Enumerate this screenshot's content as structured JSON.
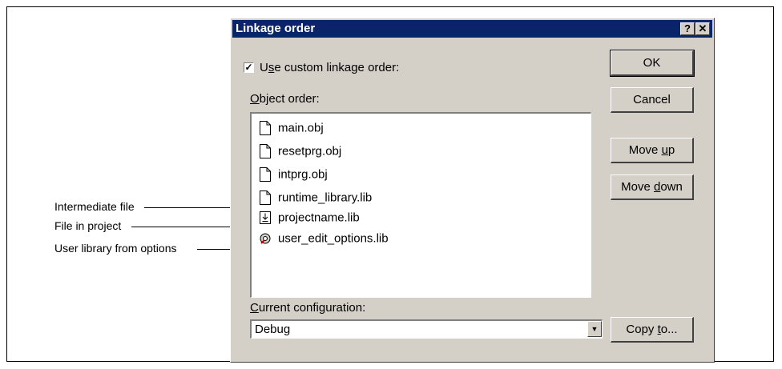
{
  "dialog": {
    "title": "Linkage order",
    "help_button": "?",
    "close_button": "✕"
  },
  "checkbox": {
    "checked": true,
    "label_pre": "U",
    "label_ul": "s",
    "label_post": "e custom linkage order:"
  },
  "object_order": {
    "label_ul": "O",
    "label_post": "bject order:",
    "items": [
      {
        "name": "main.obj",
        "icon": "file-icon"
      },
      {
        "name": "resetprg.obj",
        "icon": "file-icon"
      },
      {
        "name": "intprg.obj",
        "icon": "file-icon"
      },
      {
        "name": "runtime_library.lib",
        "icon": "file-icon"
      },
      {
        "name": "projectname.lib",
        "icon": "project-file-icon"
      },
      {
        "name": "user_edit_options.lib",
        "icon": "user-library-icon"
      }
    ]
  },
  "buttons": {
    "ok": "OK",
    "cancel": "Cancel",
    "move_up_pre": "Move ",
    "move_up_ul": "u",
    "move_up_post": "p",
    "move_down_pre": "Move ",
    "move_down_ul": "d",
    "move_down_post": "own",
    "copy_pre": "Copy ",
    "copy_ul": "t",
    "copy_post": "o..."
  },
  "configuration": {
    "label_ul": "C",
    "label_post": "urrent configuration:",
    "selected": "Debug"
  },
  "callouts": {
    "intermediate": "Intermediate file",
    "project": "File in project",
    "user_library": "User library from options"
  }
}
